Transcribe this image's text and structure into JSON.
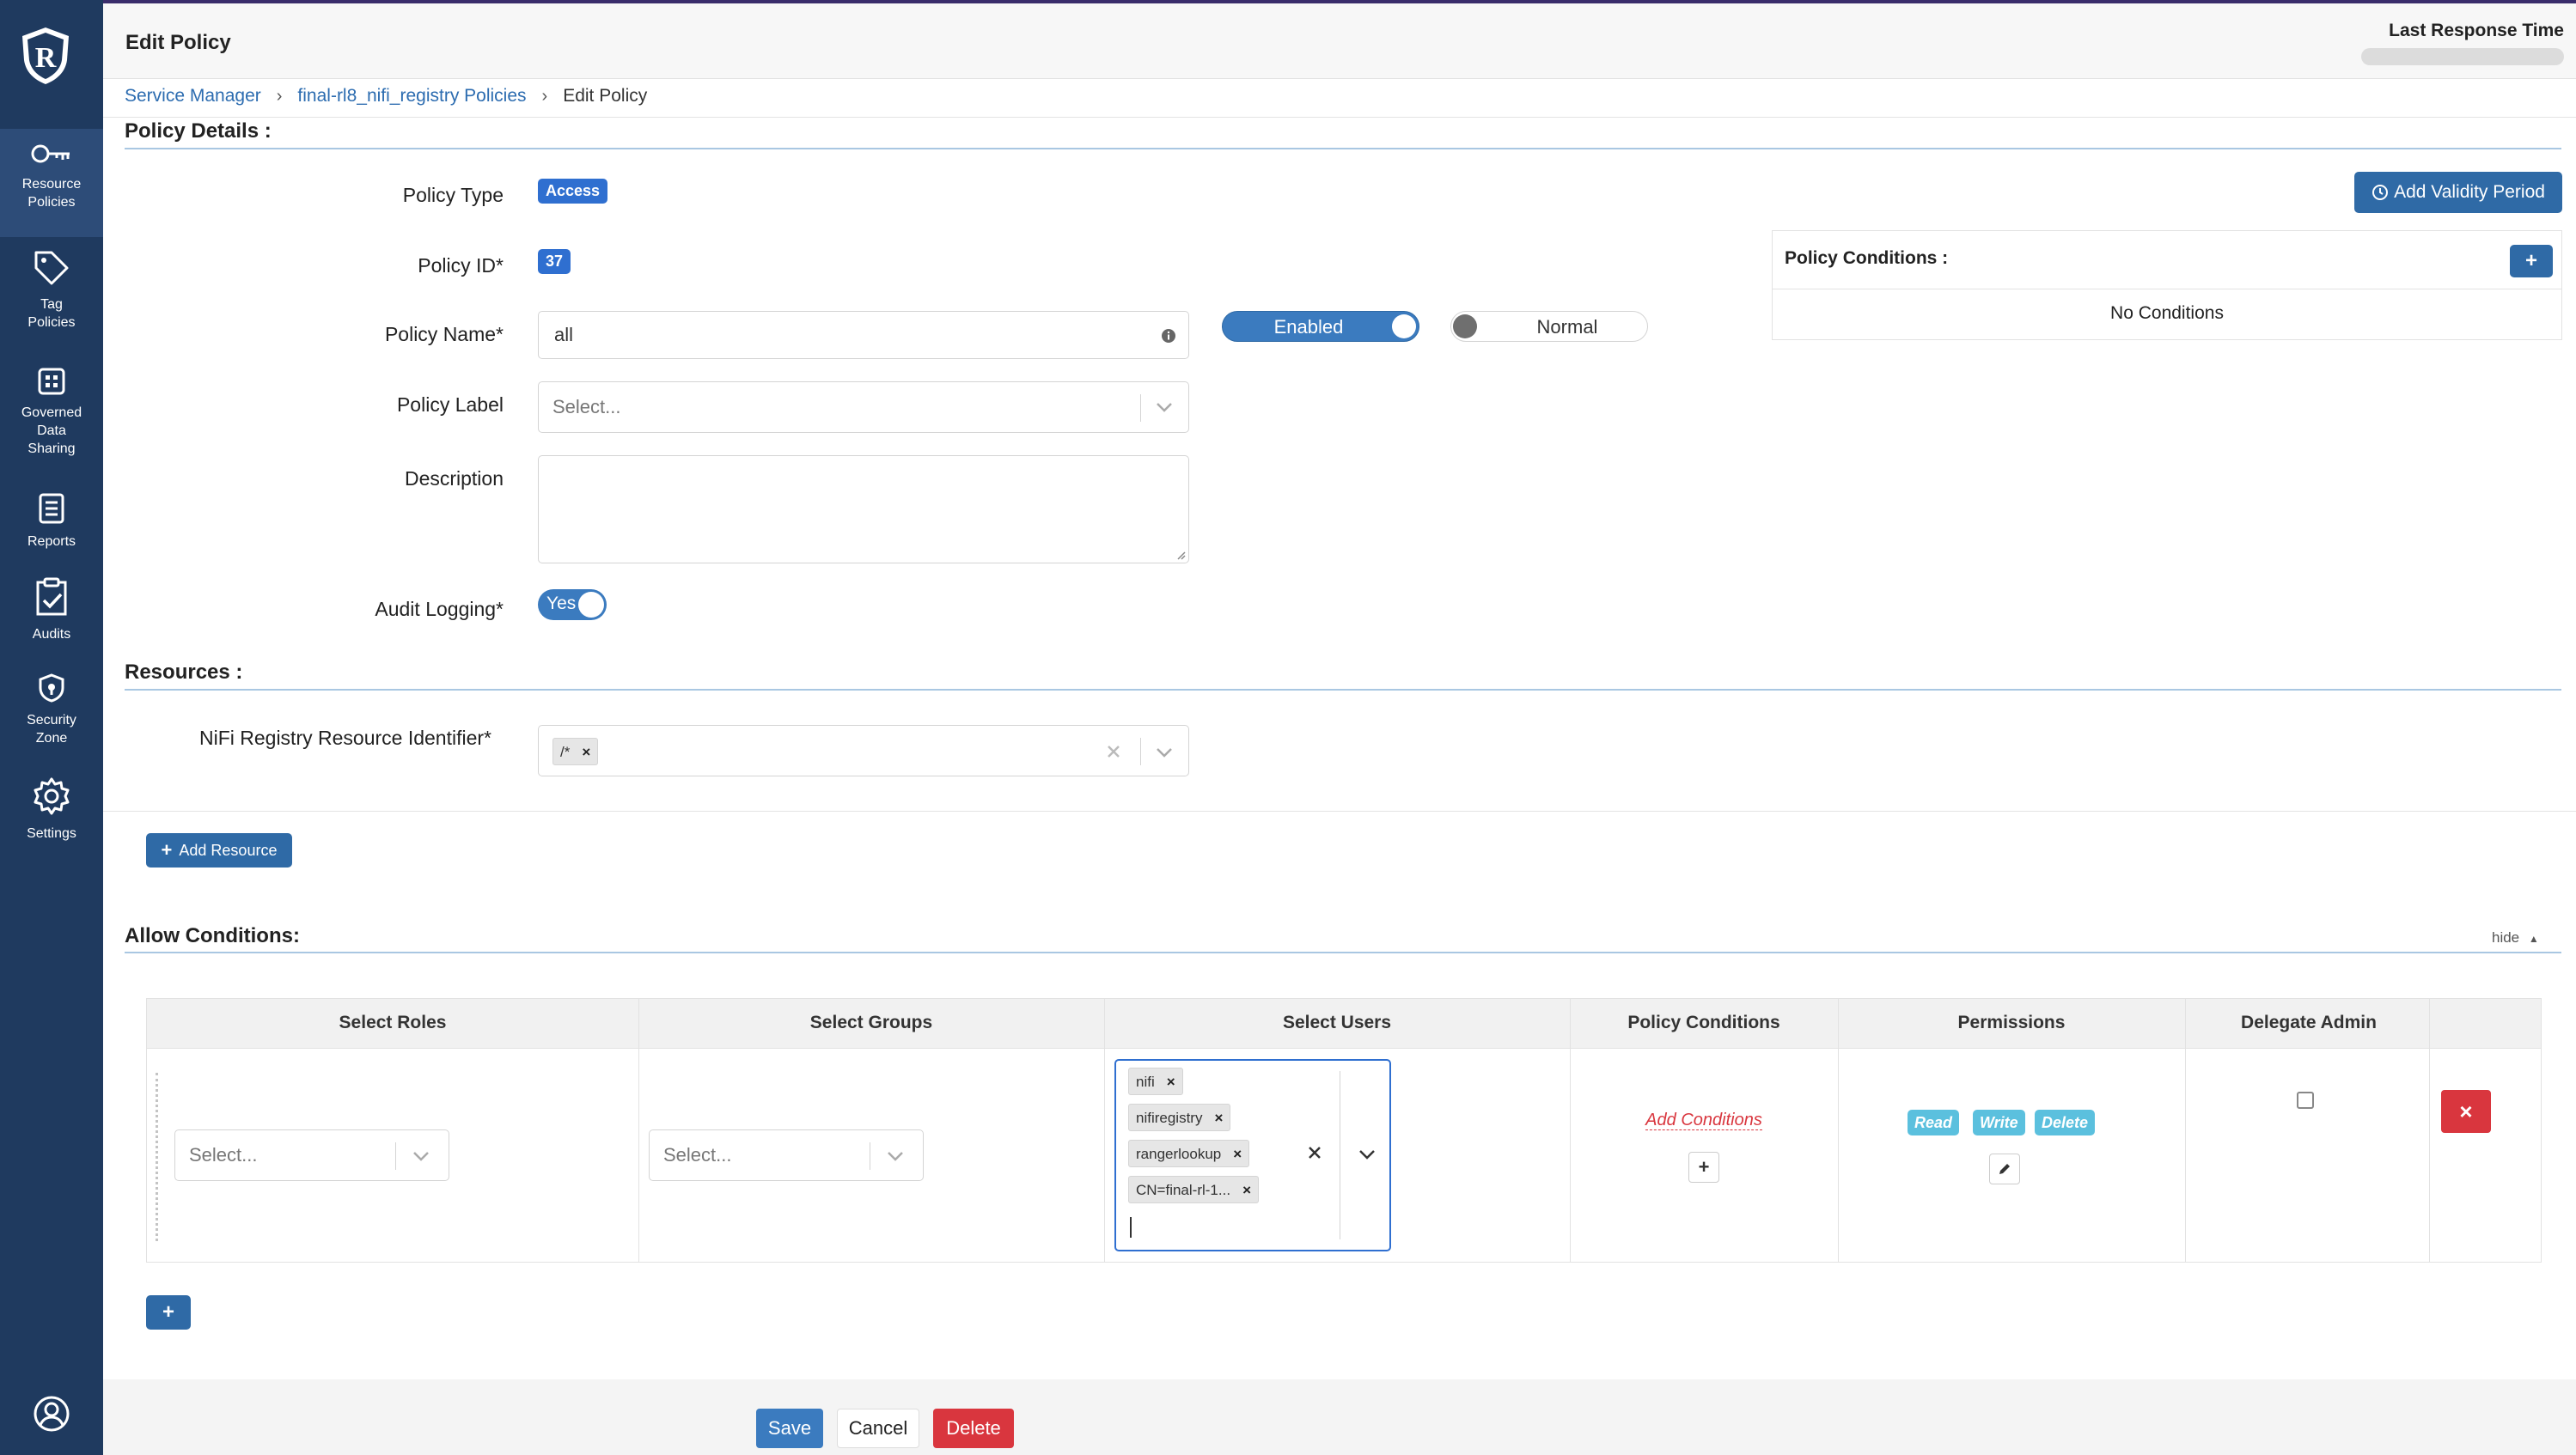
{
  "header": {
    "title": "Edit Policy",
    "last_response_label": "Last Response Time"
  },
  "sidebar": {
    "items": [
      {
        "label1": "Resource",
        "label2": "Policies",
        "icon": "key-icon"
      },
      {
        "label1": "Tag",
        "label2": "Policies",
        "icon": "tag-icon"
      },
      {
        "label1": "Governed",
        "label2": "Data",
        "label3": "Sharing",
        "icon": "grid-icon"
      },
      {
        "label1": "Reports",
        "icon": "report-icon"
      },
      {
        "label1": "Audits",
        "icon": "clipboard-check-icon"
      },
      {
        "label1": "Security",
        "label2": "Zone",
        "icon": "shield-lock-icon"
      },
      {
        "label1": "Settings",
        "icon": "gear-icon"
      }
    ],
    "profile_icon": "user-circle-icon"
  },
  "breadcrumb": {
    "items": [
      "Service Manager",
      "final-rl8_nifi_registry Policies",
      "Edit Policy"
    ]
  },
  "policy_details": {
    "section_title": "Policy Details :",
    "policy_type_label": "Policy Type",
    "policy_type_value": "Access",
    "policy_id_label": "Policy ID*",
    "policy_id_value": "37",
    "policy_name_label": "Policy Name*",
    "policy_name_value": "all",
    "enabled_toggle": "Enabled",
    "normal_toggle": "Normal",
    "policy_label_label": "Policy Label",
    "policy_label_placeholder": "Select...",
    "description_label": "Description",
    "description_value": "",
    "audit_logging_label": "Audit Logging*",
    "audit_logging_value": "Yes",
    "add_validity_label": "Add Validity Period"
  },
  "policy_conditions_panel": {
    "title": "Policy Conditions :",
    "empty_text": "No Conditions"
  },
  "resources": {
    "section_title": "Resources :",
    "identifier_label": "NiFi Registry Resource Identifier*",
    "identifier_values": [
      "/*"
    ],
    "add_resource_label": "Add Resource"
  },
  "allow_conditions": {
    "section_title": "Allow Conditions:",
    "hide_label": "hide",
    "columns": [
      "Select Roles",
      "Select Groups",
      "Select Users",
      "Policy Conditions",
      "Permissions",
      "Delegate Admin"
    ],
    "roles_placeholder": "Select...",
    "groups_placeholder": "Select...",
    "users": [
      "nifi",
      "nifiregistry",
      "rangerlookup",
      "CN=final-rl-1..."
    ],
    "add_conditions_label": "Add Conditions",
    "permissions": [
      "Read",
      "Write",
      "Delete"
    ],
    "delegate_admin": false
  },
  "footer": {
    "save_label": "Save",
    "cancel_label": "Cancel",
    "delete_label": "Delete"
  },
  "colors": {
    "sidebar_bg": "#1f3a5f",
    "primary": "#2f6aa6",
    "danger": "#d9363e",
    "badge": "#2f6fd0",
    "permission_tag": "#5bc0de"
  }
}
